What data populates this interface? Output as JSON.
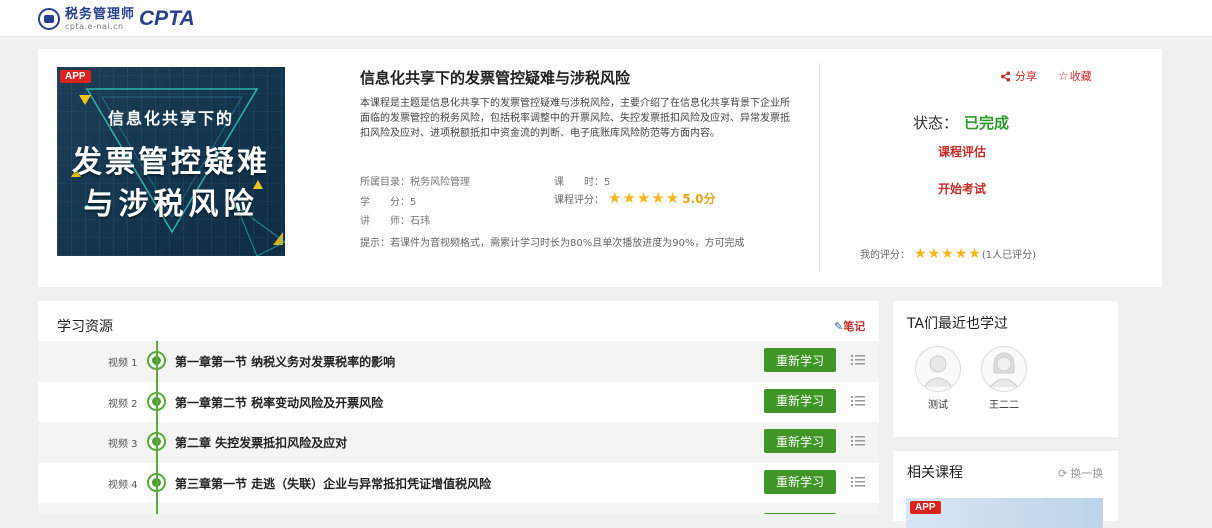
{
  "header": {
    "logo_cn": "税务管理师",
    "logo_en": "CPTA",
    "logo_url": "cpta.e-nai.cn"
  },
  "course": {
    "cover": {
      "badge": "APP",
      "line1": "信息化共享下的",
      "line2": "发票管控疑难",
      "line3": "与涉税风险"
    },
    "title": "信息化共享下的发票管控疑难与涉税风险",
    "description": "本课程是主题是信息化共享下的发票管控疑难与涉税风险，主要介绍了在信息化共享背景下企业所面临的发票管控的税务风险，包括税率调整中的开票风险、失控发票抵扣风险及应对、异常发票抵扣风险及应对、进项税额抵扣中资金流的判断、电子底账库风险防范等方面内容。",
    "meta": {
      "category_label": "所属目录：",
      "category_value": "税务风险管理",
      "hours_label": "课　　时：",
      "hours_value": "5",
      "credits_label": "学　　分：",
      "credits_value": "5",
      "teacher_label": "讲　　师：",
      "teacher_value": "石玮",
      "rating_label": "课程评分：",
      "rating_value": 5,
      "rating_text": "5.0分"
    },
    "hint": "提示：若课件为音视频格式，需累计学习时长为80%且单次播放进度为90%，方可完成"
  },
  "side": {
    "share": "分享",
    "favorite": "收藏",
    "status_label": "状态：",
    "status_value": "已完成",
    "evaluate": "课程评估",
    "exam": "开始考试",
    "my_rating_label": "我的评分：",
    "my_rating_value": 5,
    "my_rating_count": "(1人已评分)"
  },
  "resources": {
    "title": "学习资源",
    "note": "笔记",
    "relearn_label": "重新学习",
    "items": [
      {
        "label": "视频 1",
        "title": "第一章第一节 纳税义务对发票税率的影响"
      },
      {
        "label": "视频 2",
        "title": "第一章第二节 税率变动风险及开票风险"
      },
      {
        "label": "视频 3",
        "title": "第二章 失控发票抵扣风险及应对"
      },
      {
        "label": "视频 4",
        "title": "第三章第一节 走逃（失联）企业与异常抵扣凭证增值税风险"
      }
    ]
  },
  "learners": {
    "title": "TA们最近也学过",
    "users": [
      {
        "name": "测试"
      },
      {
        "name": "王二二"
      }
    ]
  },
  "related": {
    "title": "相关课程",
    "refresh": "换一换",
    "badge": "APP"
  },
  "colors": {
    "accent_red": "#c62d2d",
    "complete_green": "#2e9a2e",
    "button_green": "#3f9526",
    "star_gold": "#f5b51d"
  }
}
